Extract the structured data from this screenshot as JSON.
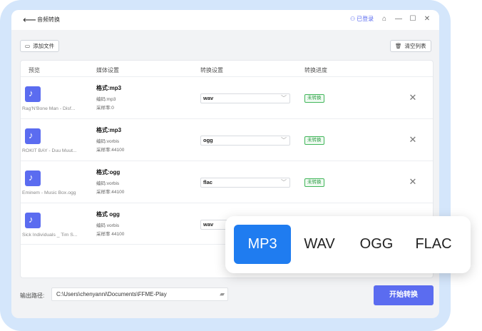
{
  "titlebar": {
    "back_icon": "arrow-left-icon",
    "title": "音频转换",
    "login": "已登录",
    "icons": [
      "user-icon",
      "hat-icon",
      "minimize-icon",
      "maximize-icon",
      "close-icon"
    ]
  },
  "toolbar": {
    "add_file": "添加文件",
    "clear_list": "清空列表"
  },
  "table": {
    "headers": [
      "预览",
      "媒体设置",
      "转换设置",
      "转换进度"
    ],
    "rows": [
      {
        "name": "Rag'N'Bone Man - Disf...",
        "format": "格式:mp3",
        "codec": "编码:mp3",
        "sample": "采样率:0",
        "target": "wav",
        "status": "未转换"
      },
      {
        "name": "ROKIT BAY - Duu Muut...",
        "format": "格式:mp3",
        "codec": "编码:vorbis",
        "sample": "采样率:44100",
        "target": "ogg",
        "status": "未转换"
      },
      {
        "name": "Eminem - Music Box.ogg",
        "format": "格式:ogg",
        "codec": "编码:vorbis",
        "sample": "采样率:44100",
        "target": "flac",
        "status": "未转换"
      },
      {
        "name": "Sick Individuals _ Tim S...",
        "format": "格式 ogg",
        "codec": "编码 vorbis",
        "sample": "采样率 44100",
        "target": "wav",
        "status": ""
      }
    ]
  },
  "footer": {
    "path_label": "输出路径:",
    "path_value": "C:\\Users\\chenyanni\\Documents\\FFME-Play",
    "start": "开始转换"
  },
  "popup": {
    "options": [
      "MP3",
      "WAV",
      "OGG",
      "FLAC"
    ],
    "selected": "MP3"
  },
  "colors": {
    "accent": "#5b6cf0",
    "popup_active": "#1f7cf0",
    "status_green": "#2f9e47",
    "frame": "#d4e6fb"
  }
}
